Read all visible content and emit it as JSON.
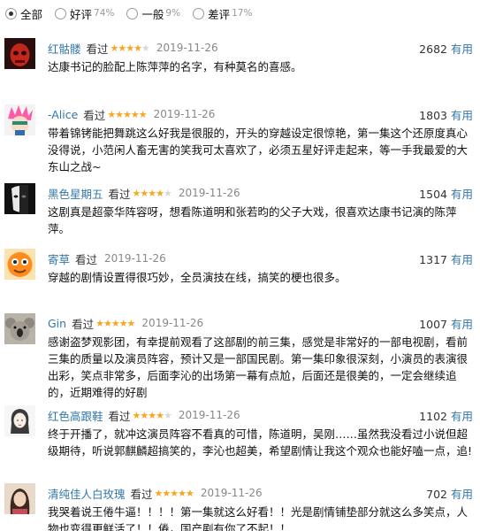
{
  "filters": [
    {
      "label": "全部",
      "pct": "",
      "checked": true
    },
    {
      "label": "好评",
      "pct": "74%",
      "checked": false
    },
    {
      "label": "一般",
      "pct": "9%",
      "checked": false
    },
    {
      "label": "差评",
      "pct": "17%",
      "checked": false
    }
  ],
  "seen_label": "看过",
  "useful_label": "有用",
  "comments": [
    {
      "user": "红骷髅",
      "rating": 4,
      "date": "2019-11-26",
      "votes": "2682",
      "text": "达康书记的脸配上陈萍萍的名字，有种莫名的喜感。"
    },
    {
      "user": "-Alice",
      "rating": 5,
      "date": "2019-11-26",
      "votes": "1803",
      "text": "带着锦铐能把舞跳这么好我是很服的，开头的穿越设定很惊艳，第一集这个还原度真心没得说，小范闲人畜无害的笑我可太喜欢了，必须五星好评走起来，等一手我最爱的大东山之战~"
    },
    {
      "user": "黑色星期五",
      "rating": 4,
      "date": "2019-11-26",
      "votes": "1504",
      "text": "这剧真是超豪华阵容呀，想看陈道明和张若昀的父子大戏，很喜欢达康书记演的陈萍萍。"
    },
    {
      "user": "寄草",
      "rating": 0,
      "date": "2019-11-26",
      "votes": "1317",
      "text": "穿越的剧情设置得很巧妙，全员演技在线，搞笑的梗也很多。"
    },
    {
      "user": "Gin",
      "rating": 5,
      "date": "2019-11-26",
      "votes": "1007",
      "text": "感谢盗梦观影团，有幸提前观看了这部剧的前三集，感觉是非常好的一部电视剧，看前三集的质量以及演员阵容，预计又是一部国民剧。第一集印象很深刻，小演员的表演很出彩，笑点非常多，后面李沁的出场第一幕有点尬，后面还是很美的，一定会继续追的，近期难得的好剧"
    },
    {
      "user": "红色高跟鞋",
      "rating": 4,
      "date": "2019-11-26",
      "votes": "1102",
      "text": "终于开播了，就冲这演员阵容不看真的可惜，陈道明，吴刚……虽然我没看过小说但超级期待，听说郭麒麟超搞笑的，李沁也超美，希望剧情让我这个观众也能好嗑一点，追!"
    },
    {
      "user": "清纯佳人白玫瑰",
      "rating": 5,
      "date": "2019-11-26",
      "votes": "702",
      "text": "我哭着说王倦牛逼！！！！第一集就这么好看！！光是剧情铺垫部分就这么多笑点，人物也变得更鲜活了！！倦，国产剧有你了不起！！"
    }
  ],
  "colors": {
    "link": "#3377aa",
    "star": "#f5a623",
    "muted": "#888888"
  },
  "icons": [
    "red-skull-avatar-icon",
    "pink-hair-avatar-icon",
    "masked-face-avatar-icon",
    "orange-cartoon-avatar-icon",
    "koala-avatar-icon",
    "sketch-girl-avatar-icon",
    "portrait-avatar-icon"
  ]
}
